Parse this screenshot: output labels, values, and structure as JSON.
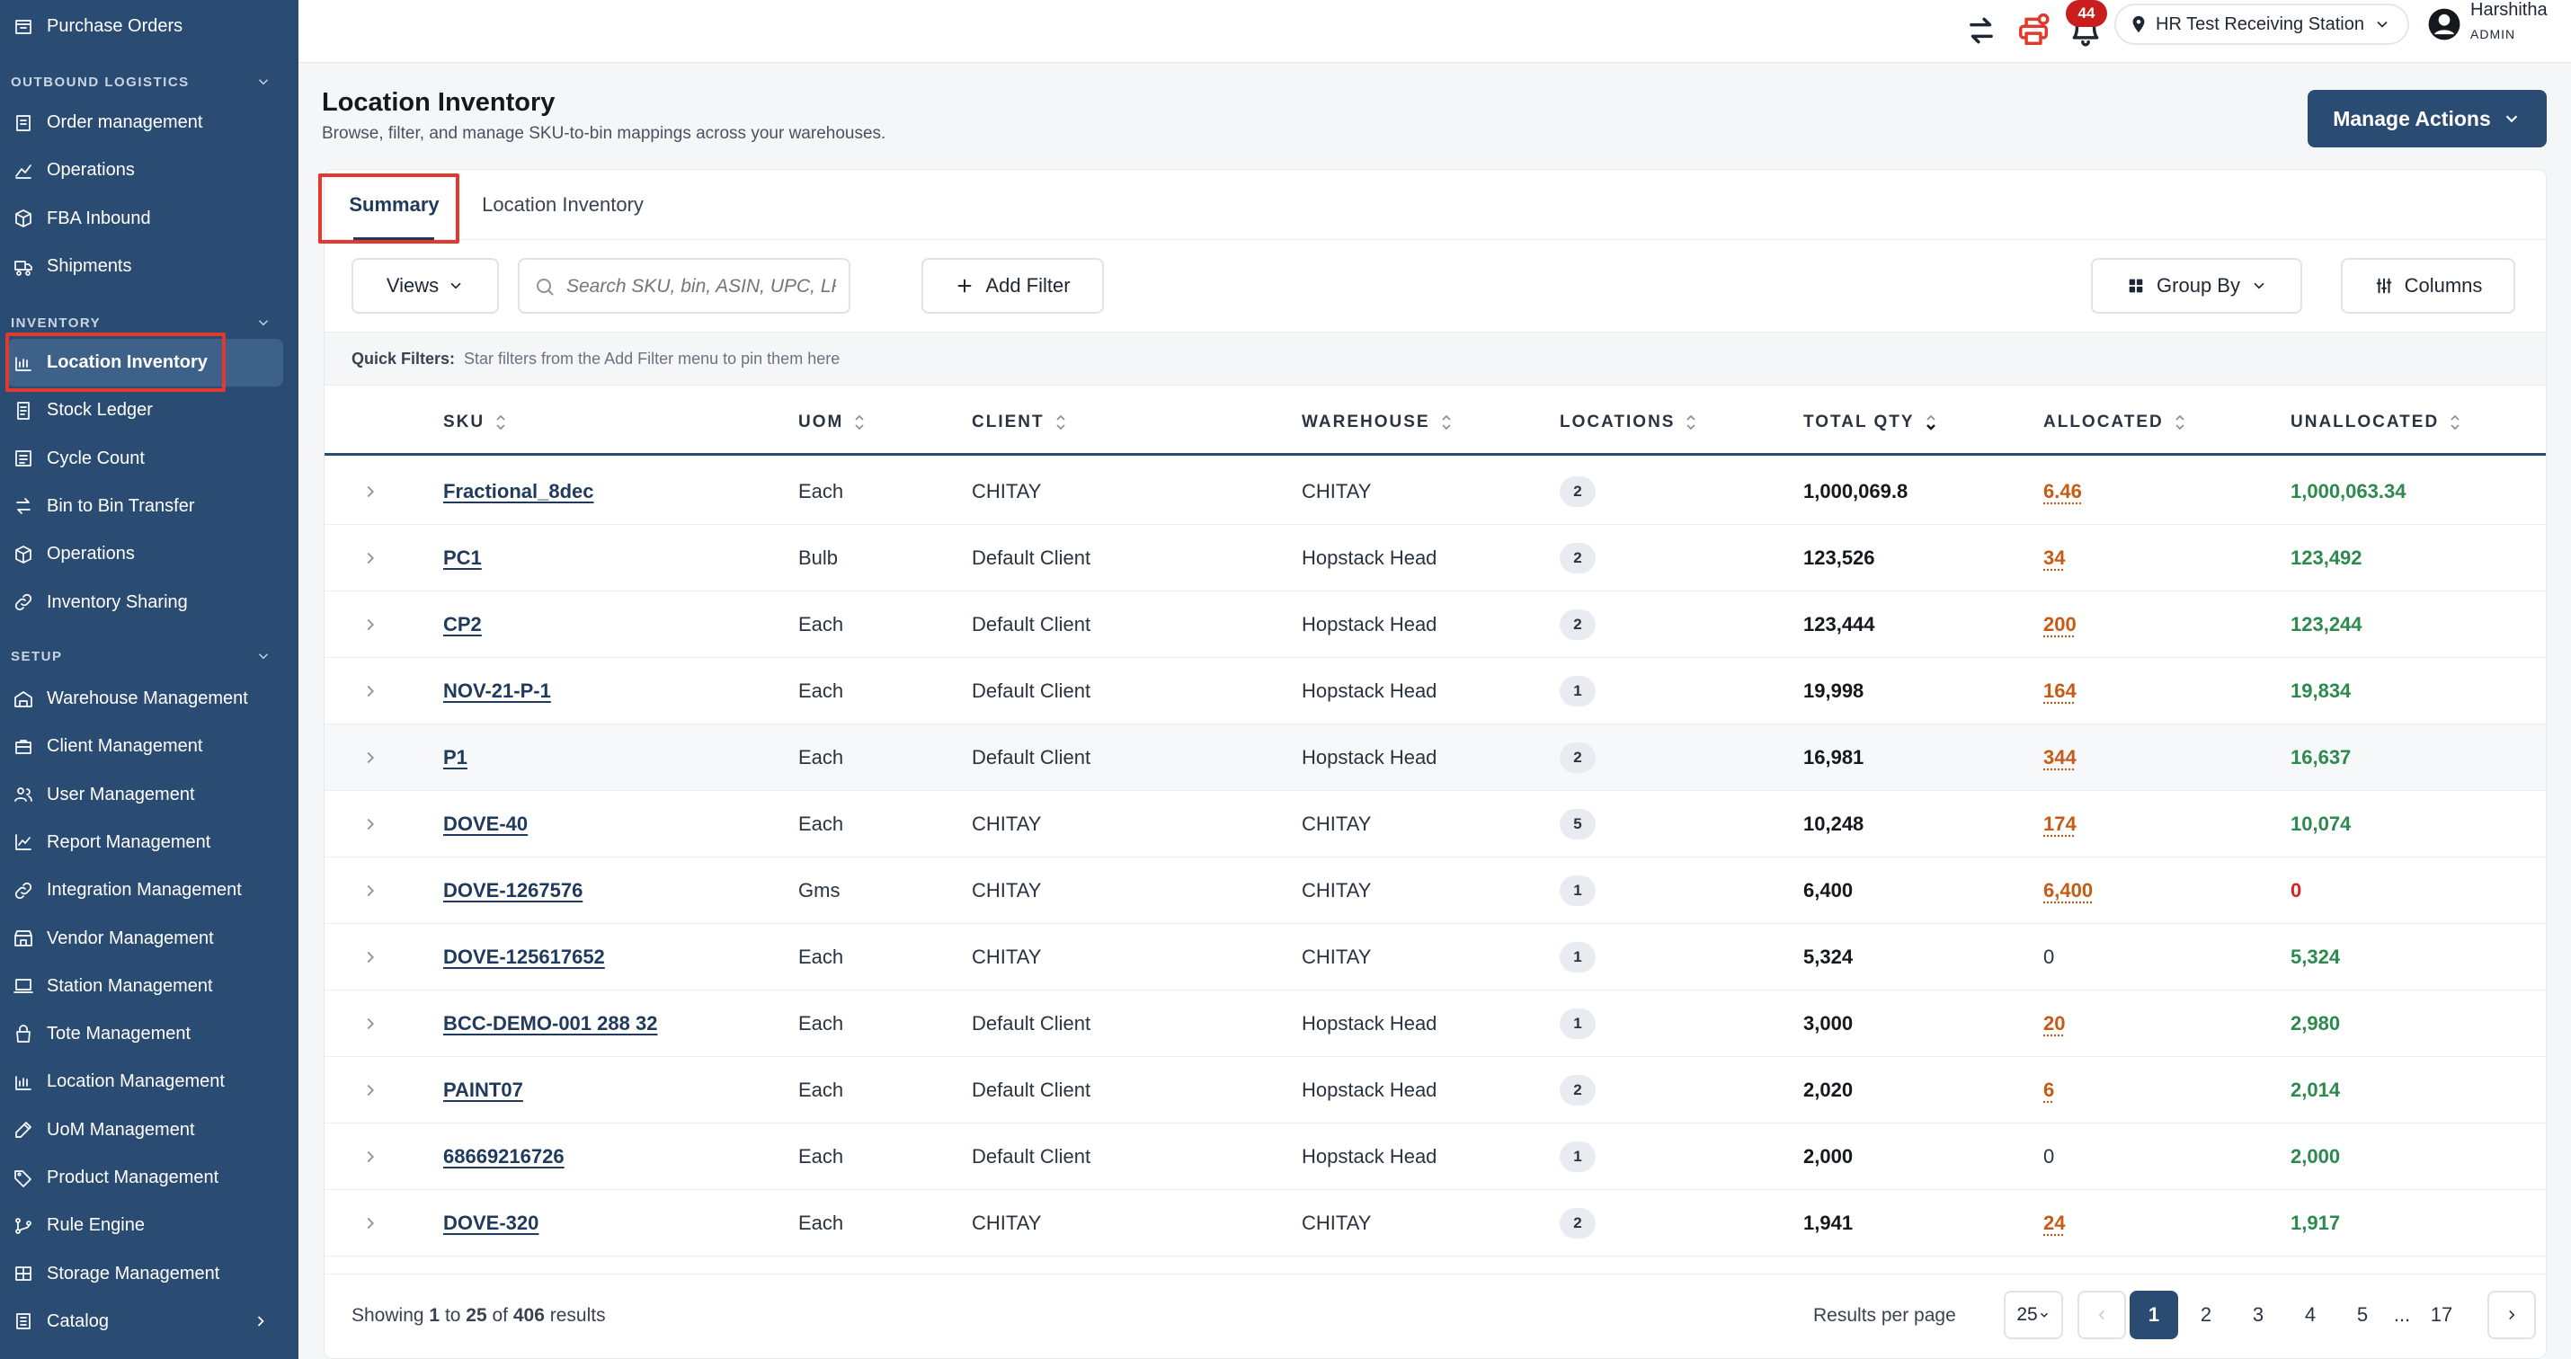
{
  "sidebar": {
    "top_item": "Purchase Orders",
    "sections": [
      {
        "title": "OUTBOUND LOGISTICS",
        "items": [
          "Order management",
          "Operations",
          "FBA Inbound",
          "Shipments"
        ]
      },
      {
        "title": "INVENTORY",
        "items": [
          "Location Inventory",
          "Stock Ledger",
          "Cycle Count",
          "Bin to Bin Transfer",
          "Operations",
          "Inventory Sharing"
        ]
      },
      {
        "title": "SETUP",
        "items": [
          "Warehouse Management",
          "Client Management",
          "User Management",
          "Report Management",
          "Integration Management",
          "Vendor Management",
          "Station Management",
          "Tote Management",
          "Location Management",
          "UoM Management",
          "Product Management",
          "Rule Engine",
          "Storage Management",
          "Catalog"
        ]
      }
    ],
    "active_item": "Location Inventory"
  },
  "topbar": {
    "notification_count": "44",
    "station": "HR Test Receiving Station",
    "user_name": "Harshitha",
    "user_role": "ADMIN"
  },
  "page": {
    "title": "Location Inventory",
    "subtitle": "Browse, filter, and manage SKU-to-bin mappings across your warehouses.",
    "manage_actions": "Manage Actions"
  },
  "tabs": [
    "Summary",
    "Location Inventory"
  ],
  "toolbar": {
    "views": "Views",
    "search_placeholder": "Search SKU, bin, ASIN, UPC, LP",
    "add_filter": "Add Filter",
    "group_by": "Group By",
    "columns": "Columns"
  },
  "quick_filters": {
    "label": "Quick Filters:",
    "hint": "Star filters from the Add Filter menu to pin them here"
  },
  "table": {
    "columns": [
      "SKU",
      "UOM",
      "CLIENT",
      "WAREHOUSE",
      "LOCATIONS",
      "TOTAL QTY",
      "ALLOCATED",
      "UNALLOCATED"
    ],
    "rows": [
      {
        "sku": "Fractional_8dec",
        "uom": "Each",
        "client": "CHITAY",
        "warehouse": "CHITAY",
        "locations": "2",
        "total_qty": "1,000,069.8",
        "allocated": "6.46",
        "unallocated": "1,000,063.34"
      },
      {
        "sku": "PC1",
        "uom": "Bulb",
        "client": "Default Client",
        "warehouse": "Hopstack Head",
        "locations": "2",
        "total_qty": "123,526",
        "allocated": "34",
        "unallocated": "123,492"
      },
      {
        "sku": "CP2",
        "uom": "Each",
        "client": "Default Client",
        "warehouse": "Hopstack Head",
        "locations": "2",
        "total_qty": "123,444",
        "allocated": "200",
        "unallocated": "123,244"
      },
      {
        "sku": "NOV-21-P-1",
        "uom": "Each",
        "client": "Default Client",
        "warehouse": "Hopstack Head",
        "locations": "1",
        "total_qty": "19,998",
        "allocated": "164",
        "unallocated": "19,834"
      },
      {
        "sku": "P1",
        "uom": "Each",
        "client": "Default Client",
        "warehouse": "Hopstack Head",
        "locations": "2",
        "total_qty": "16,981",
        "allocated": "344",
        "unallocated": "16,637"
      },
      {
        "sku": "DOVE-40",
        "uom": "Each",
        "client": "CHITAY",
        "warehouse": "CHITAY",
        "locations": "5",
        "total_qty": "10,248",
        "allocated": "174",
        "unallocated": "10,074"
      },
      {
        "sku": "DOVE-1267576",
        "uom": "Gms",
        "client": "CHITAY",
        "warehouse": "CHITAY",
        "locations": "1",
        "total_qty": "6,400",
        "allocated": "6,400",
        "unallocated": "0"
      },
      {
        "sku": "DOVE-125617652",
        "uom": "Each",
        "client": "CHITAY",
        "warehouse": "CHITAY",
        "locations": "1",
        "total_qty": "5,324",
        "allocated": "0",
        "unallocated": "5,324"
      },
      {
        "sku": "BCC-DEMO-001 288 32",
        "uom": "Each",
        "client": "Default Client",
        "warehouse": "Hopstack Head",
        "locations": "1",
        "total_qty": "3,000",
        "allocated": "20",
        "unallocated": "2,980"
      },
      {
        "sku": "PAINT07",
        "uom": "Each",
        "client": "Default Client",
        "warehouse": "Hopstack Head",
        "locations": "2",
        "total_qty": "2,020",
        "allocated": "6",
        "unallocated": "2,014"
      },
      {
        "sku": "68669216726",
        "uom": "Each",
        "client": "Default Client",
        "warehouse": "Hopstack Head",
        "locations": "1",
        "total_qty": "2,000",
        "allocated": "0",
        "unallocated": "2,000"
      },
      {
        "sku": "DOVE-320",
        "uom": "Each",
        "client": "CHITAY",
        "warehouse": "CHITAY",
        "locations": "2",
        "total_qty": "1,941",
        "allocated": "24",
        "unallocated": "1,917"
      }
    ]
  },
  "footer": {
    "showing_prefix": "Showing",
    "from": "1",
    "to_word": "to",
    "to": "25",
    "of_word": "of",
    "total": "406",
    "results_word": "results",
    "per_page_label": "Results per page",
    "per_page_value": "25",
    "pages": [
      "1",
      "2",
      "3",
      "4",
      "5",
      "...",
      "17"
    ],
    "current_page": "1"
  },
  "colors": {
    "sidebar": "#2b4c72",
    "accent": "#2b4c72",
    "allocated": "#c75a14",
    "unallocated": "#2d8a4e",
    "highlight": "#e03a2e"
  }
}
